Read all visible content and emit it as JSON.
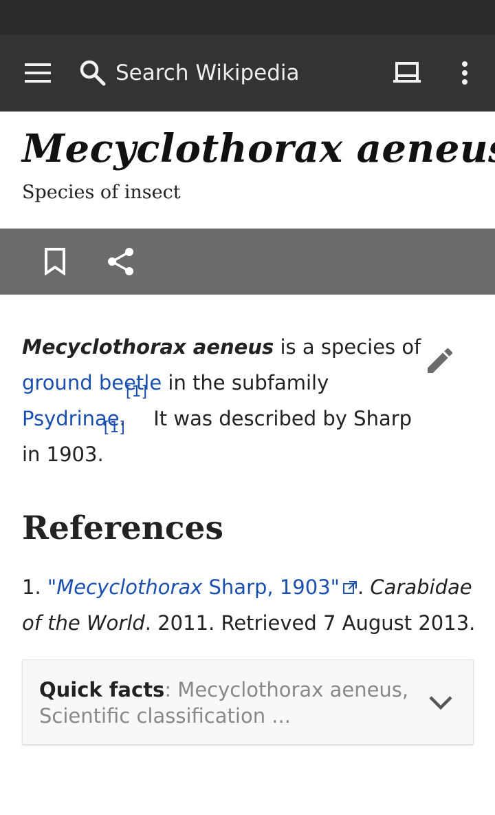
{
  "toolbar": {
    "search_placeholder": "Search Wikipedia"
  },
  "article": {
    "title": "Mecyclothorax aeneus",
    "subtitle": "Species of insect"
  },
  "lead": {
    "bold_name": "Mecyclothorax aeneus",
    "text1": " is a species of ",
    "link_ground_beetle": "ground beetle",
    "text2": " in the subfamily ",
    "link_psydrinae": "Psydrinae",
    "text3": ".",
    "ref_marker": "[1]",
    "text4": " It was described by Sharp in 1903.",
    "ref_marker_2": "[1]"
  },
  "references": {
    "heading": "References",
    "items": [
      {
        "number": "1.",
        "link_open_quote": "\"",
        "link_italic": "Mecyclothorax",
        "link_rest": " Sharp, 1903\"",
        "after_link": ". ",
        "work": "Carabidae of the World",
        "rest": ". 2011. Retrieved 7 August 2013."
      }
    ]
  },
  "quick_facts": {
    "label": "Quick facts",
    "text": ": Mecyclothorax aeneus, Scientific classification ..."
  },
  "icons": {
    "menu": "hamburger-menu-icon",
    "search": "search-icon",
    "tabs": "tabs-icon",
    "overflow": "more-vert-icon",
    "bookmark": "bookmark-icon",
    "share": "share-icon",
    "edit": "pencil-icon",
    "external": "external-link-icon",
    "expand": "chevron-down-icon"
  },
  "colors": {
    "toolbar_bg": "#333333",
    "action_bar_bg": "#6b6b6b",
    "link": "#1a4fb0"
  }
}
